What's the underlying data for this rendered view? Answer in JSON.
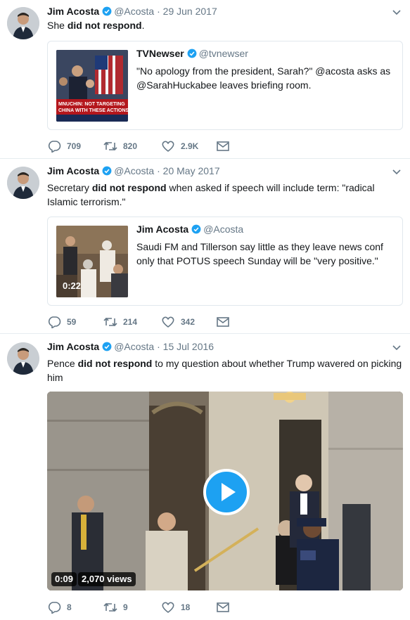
{
  "tweets": [
    {
      "name": "Jim Acosta",
      "handle": "@Acosta",
      "date": "29 Jun 2017",
      "text_pre": "She ",
      "text_bold": "did not respond",
      "text_post": ".",
      "quote": {
        "name": "TVNewser",
        "handle": "@tvnewser",
        "text": "\"No apology from the president, Sarah?\" @acosta asks as @SarahHuckabee leaves briefing room.",
        "thumb_caption": "MNUCHIN: NOT TARGETING CHINA WITH THESE ACTIONS"
      },
      "replies": "709",
      "retweets": "820",
      "likes": "2.9K"
    },
    {
      "name": "Jim Acosta",
      "handle": "@Acosta",
      "date": "20 May 2017",
      "text_pre": "Secretary ",
      "text_bold": "did not respond",
      "text_post": " when asked if speech will include term: \"radical Islamic terrorism.\"",
      "quote": {
        "name": "Jim Acosta",
        "handle": "@Acosta",
        "text": "Saudi FM and Tillerson say little as they leave news conf only that POTUS speech Sunday will be \"very positive.\"",
        "duration": "0:22"
      },
      "replies": "59",
      "retweets": "214",
      "likes": "342"
    },
    {
      "name": "Jim Acosta",
      "handle": "@Acosta",
      "date": "15 Jul 2016",
      "text_pre": "Pence ",
      "text_bold": "did not respond",
      "text_post": " to my question about whether Trump wavered on picking him",
      "video": {
        "duration": "0:09",
        "views": "2,070 views"
      },
      "replies": "8",
      "retweets": "9",
      "likes": "18"
    }
  ],
  "colors": {
    "accent": "#1da1f2",
    "secondary_text": "#657786",
    "divider": "#e6ecf0"
  },
  "icons": [
    "verified-icon",
    "chevron-down-icon",
    "reply-icon",
    "retweet-icon",
    "like-icon",
    "message-icon",
    "play-icon"
  ]
}
